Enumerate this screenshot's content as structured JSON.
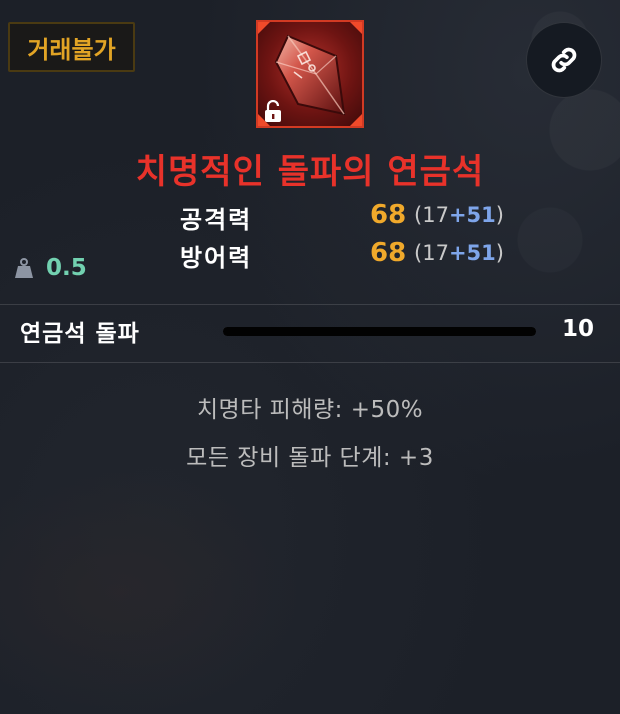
{
  "badge": {
    "label": "거래불가"
  },
  "item": {
    "name": "치명적인 돌파의 연금석",
    "icon": "red-crystal-gem-icon",
    "lock_icon": "unlock-icon",
    "rarity_color": "#e8322a"
  },
  "stats": [
    {
      "label": "공격력",
      "total": "68",
      "base": "17",
      "bonus": "+51"
    },
    {
      "label": "방어력",
      "total": "68",
      "base": "17",
      "bonus": "+51"
    }
  ],
  "weight": {
    "icon": "weight-icon",
    "value": "0.5"
  },
  "breakthrough": {
    "label": "연금석 돌파",
    "value": "10",
    "progress": 1.0
  },
  "effects": [
    "치명타 피해량: +50%",
    "모든 장비 돌파 단계: +3"
  ],
  "colors": {
    "stat_value": "#f0a92b",
    "stat_bonus": "#7ea5ea",
    "badge": "#e2a425",
    "weight": "#72d1b0"
  }
}
